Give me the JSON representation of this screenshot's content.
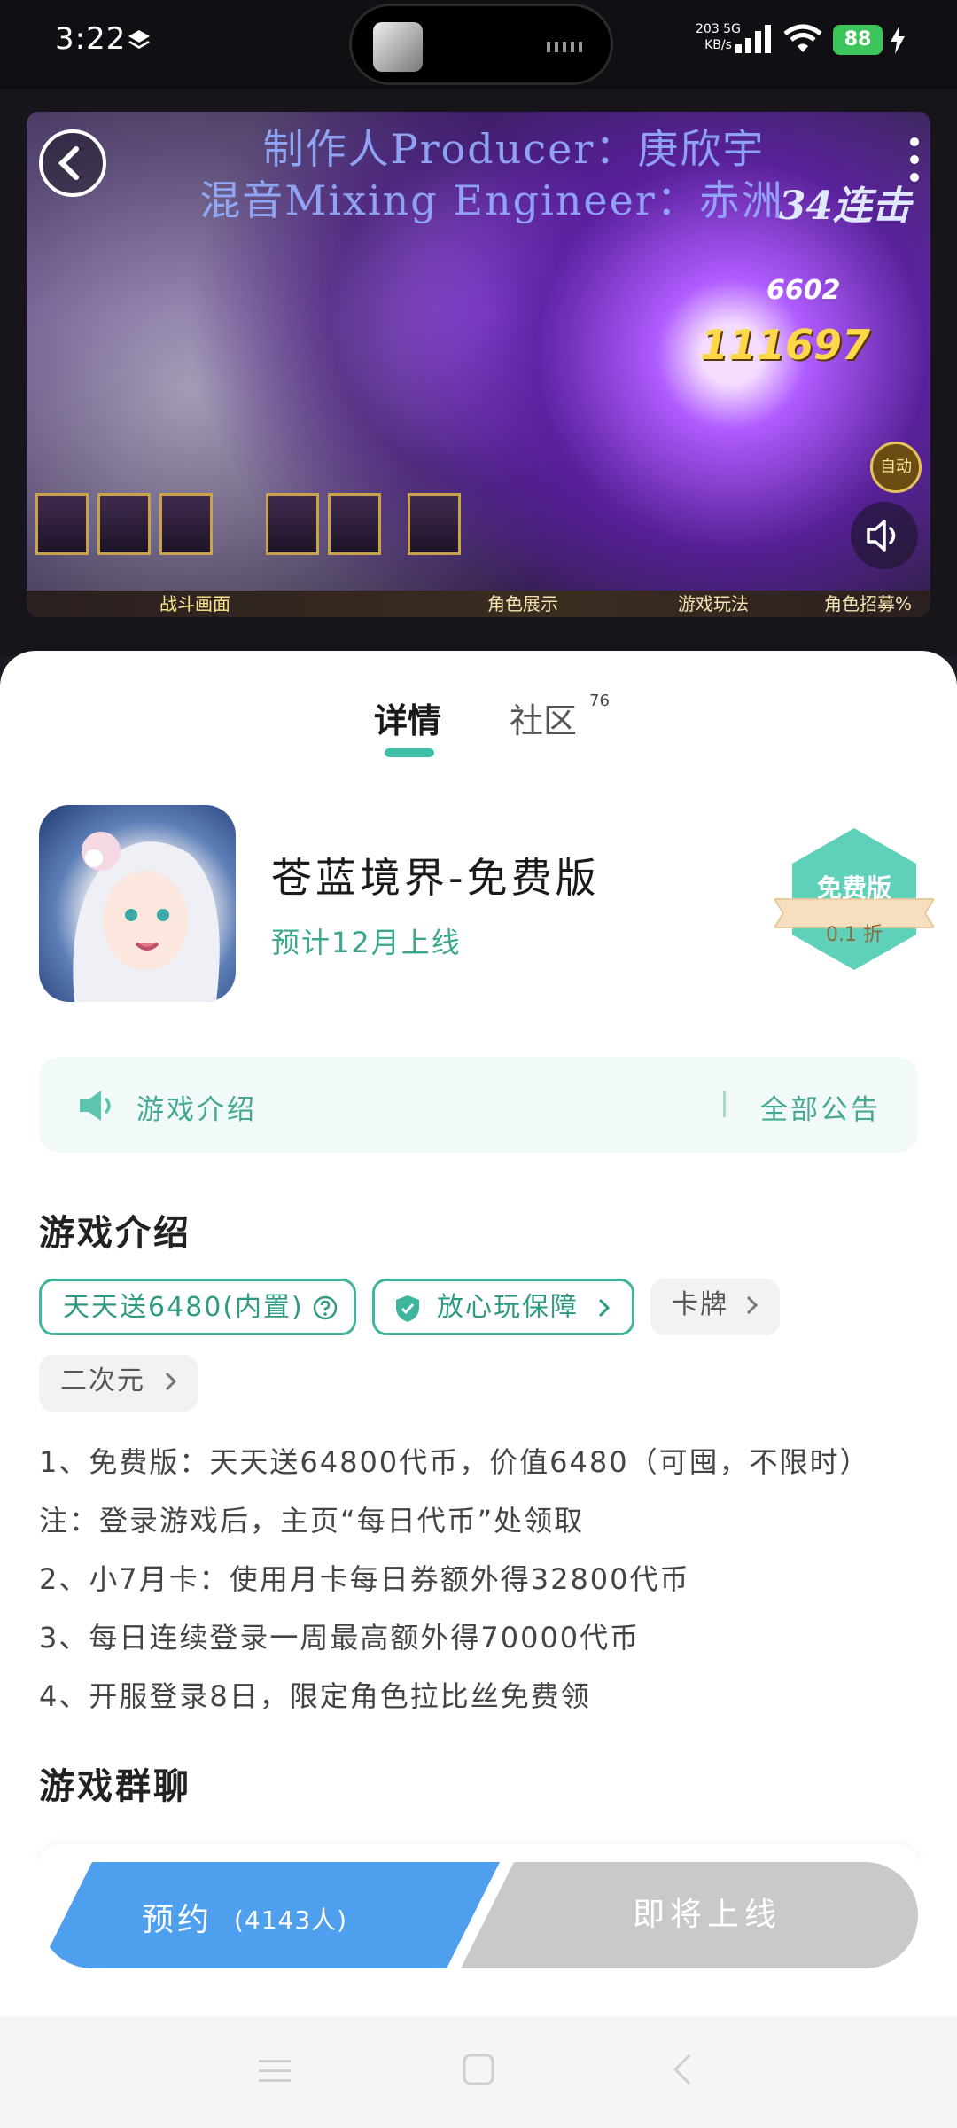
{
  "status_bar": {
    "time": "3:22",
    "net_speed_value": "203 5G",
    "net_speed_unit": "KB/s",
    "battery": "88"
  },
  "video": {
    "credit_producer": "制作人Producer：庚欣宇",
    "credit_mixing": "混音Mixing Engineer：赤洲",
    "combo": "34连击",
    "damage_small": "6602",
    "damage_big": "111697",
    "auto_label": "自动",
    "strip_labels": [
      "战斗画面",
      "角色展示",
      "游戏玩法",
      "角色招募%"
    ]
  },
  "tabs": {
    "details": "详情",
    "community": "社区",
    "community_count": "76"
  },
  "app": {
    "name": "苍蓝境界-免费版",
    "release": "预计12月上线",
    "badge_label": "免费版",
    "badge_discount": "0.1 折"
  },
  "notice": {
    "title": "游戏介绍",
    "all": "全部公告"
  },
  "intro": {
    "title": "游戏介绍",
    "tags": {
      "gift": "天天送6480(内置)",
      "safe": "放心玩保障",
      "card": "卡牌",
      "acg": "二次元"
    },
    "lines": [
      "1、免费版：天天送64800代币，价值6480（可囤，不限时）",
      "注：登录游戏后，主页“每日代币”处领取",
      "2、小7月卡：使用月卡每日券额外得32800代币",
      "3、每日连续登录一周最高额外得70000代币",
      "4、开服登录8日，限定角色拉比丝免费领"
    ]
  },
  "group": {
    "title": "游戏群聊"
  },
  "actions": {
    "reserve_label": "预约",
    "reserve_count": "(4143人)",
    "coming": "即将上线"
  },
  "colors": {
    "accent": "#3fbfa7",
    "reserve": "#4ea0ee",
    "disabled": "#c9c9c9"
  }
}
